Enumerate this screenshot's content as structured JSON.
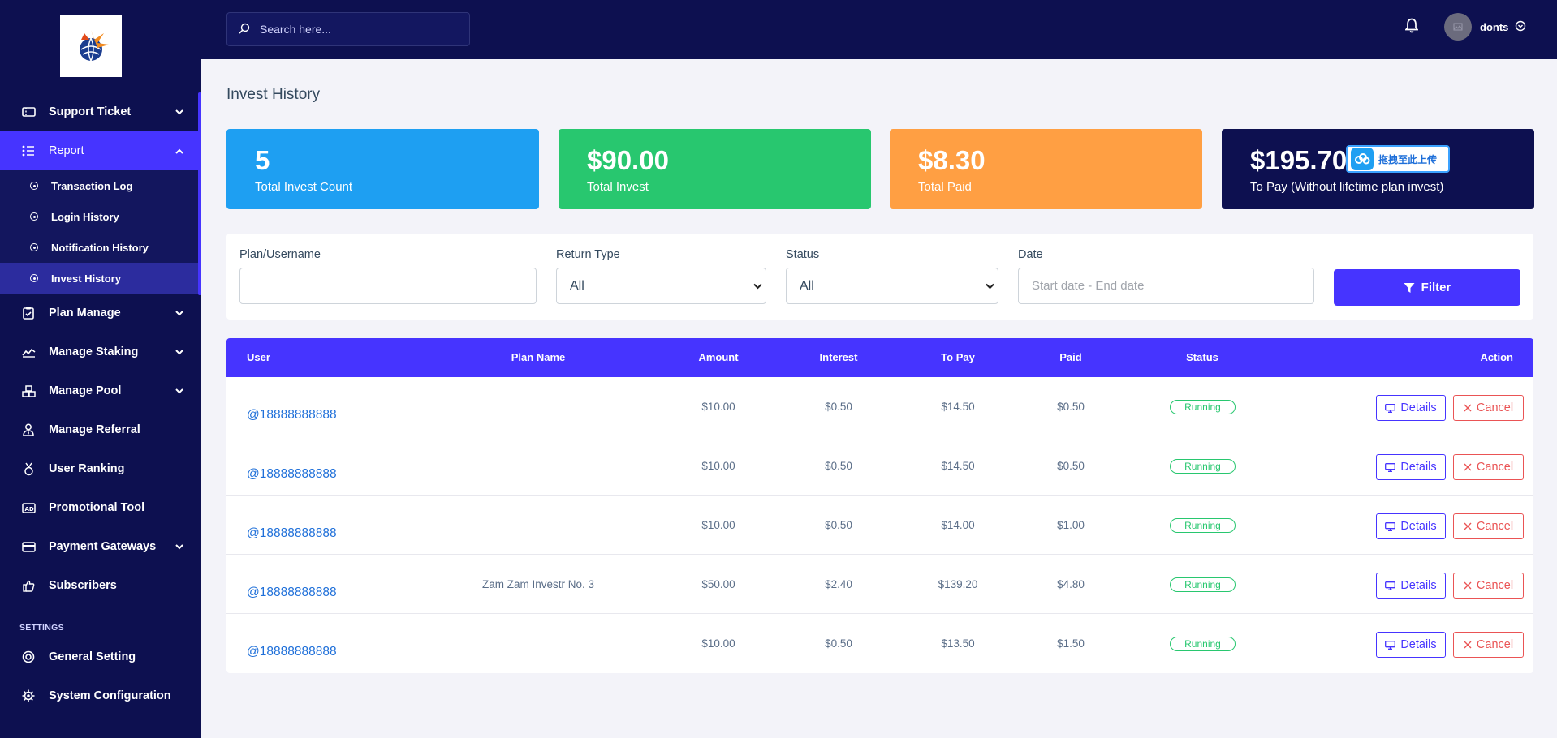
{
  "sidebar": {
    "items_top": [
      {
        "label": "Support Ticket",
        "icon": "ticket-icon",
        "has_chevron": true,
        "chevron": "down"
      },
      {
        "label": "Report",
        "icon": "list-icon",
        "has_chevron": true,
        "chevron": "up",
        "active": true
      }
    ],
    "report_sub": [
      {
        "label": "Transaction Log"
      },
      {
        "label": "Login History"
      },
      {
        "label": "Notification History"
      },
      {
        "label": "Invest History",
        "active": true
      }
    ],
    "items_bottom": [
      {
        "label": "Plan Manage",
        "icon": "clipboard-check-icon",
        "has_chevron": true
      },
      {
        "label": "Manage Staking",
        "icon": "chart-line-icon",
        "has_chevron": true
      },
      {
        "label": "Manage Pool",
        "icon": "cubes-icon",
        "has_chevron": true
      },
      {
        "label": "Manage Referral",
        "icon": "user-tie-icon",
        "has_chevron": false
      },
      {
        "label": "User Ranking",
        "icon": "medal-icon",
        "has_chevron": false
      },
      {
        "label": "Promotional Tool",
        "icon": "ad-icon",
        "has_chevron": false
      },
      {
        "label": "Payment Gateways",
        "icon": "credit-card-icon",
        "has_chevron": true
      },
      {
        "label": "Subscribers",
        "icon": "thumbs-up-icon",
        "has_chevron": false
      }
    ],
    "section_label": "SETTINGS",
    "settings_items": [
      {
        "label": "General Setting",
        "icon": "life-ring-icon"
      },
      {
        "label": "System Configuration",
        "icon": "gear-icon"
      }
    ]
  },
  "topbar": {
    "search_placeholder": "Search here...",
    "username": "donts"
  },
  "page": {
    "title": "Invest History"
  },
  "cards": [
    {
      "value": "5",
      "label": "Total Invest Count",
      "color": "#1e9ff2"
    },
    {
      "value": "$90.00",
      "label": "Total Invest",
      "color": "#28c76f"
    },
    {
      "value": "$8.30",
      "label": "Total Paid",
      "color": "#ff9f43"
    },
    {
      "value": "$195.70",
      "label": "To Pay (Without lifetime plan invest)",
      "color": "#0d1050"
    }
  ],
  "upload_badge": "拖拽至此上传",
  "filters": {
    "plan_label": "Plan/Username",
    "plan_value": "",
    "return_type_label": "Return Type",
    "return_type_value": "All",
    "status_label": "Status",
    "status_value": "All",
    "date_label": "Date",
    "date_placeholder": "Start date - End date",
    "button": "Filter"
  },
  "table": {
    "headers": [
      "User",
      "Plan Name",
      "Amount",
      "Interest",
      "To Pay",
      "Paid",
      "Status",
      "Action"
    ],
    "rows": [
      {
        "user": "@18888888888",
        "plan": "",
        "amount": "$10.00",
        "interest": "$0.50",
        "to_pay": "$14.50",
        "paid": "$0.50",
        "status": "Running"
      },
      {
        "user": "@18888888888",
        "plan": "",
        "amount": "$10.00",
        "interest": "$0.50",
        "to_pay": "$14.50",
        "paid": "$0.50",
        "status": "Running"
      },
      {
        "user": "@18888888888",
        "plan": "",
        "amount": "$10.00",
        "interest": "$0.50",
        "to_pay": "$14.00",
        "paid": "$1.00",
        "status": "Running"
      },
      {
        "user": "@18888888888",
        "plan": "Zam Zam Investr No. 3",
        "amount": "$50.00",
        "interest": "$2.40",
        "to_pay": "$139.20",
        "paid": "$4.80",
        "status": "Running"
      },
      {
        "user": "@18888888888",
        "plan": "",
        "amount": "$10.00",
        "interest": "$0.50",
        "to_pay": "$13.50",
        "paid": "$1.50",
        "status": "Running"
      }
    ],
    "details_label": "Details",
    "cancel_label": "Cancel"
  },
  "colors": {
    "sidebar_bg": "#0d1050",
    "accent": "#4634ff",
    "success": "#28c76f",
    "danger": "#ea5455",
    "link": "#1e6fd9"
  }
}
